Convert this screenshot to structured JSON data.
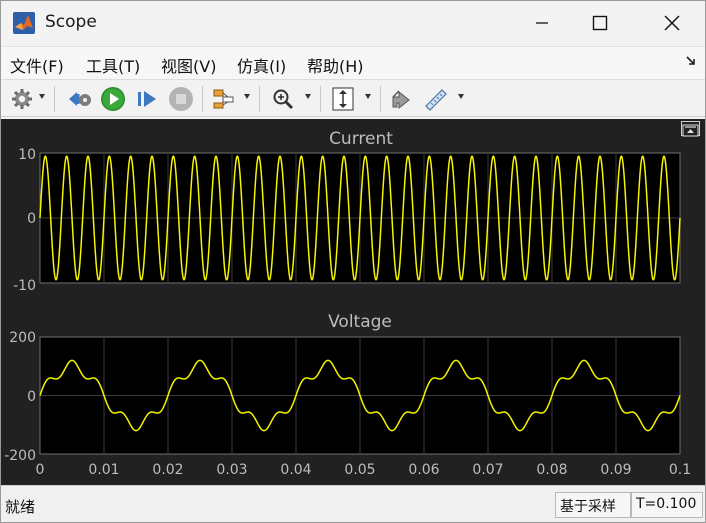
{
  "window": {
    "title": "Scope",
    "icons": {
      "app": "matlab-logo-icon",
      "minimize": "minimize-icon",
      "maximize": "maximize-icon",
      "close": "close-icon"
    }
  },
  "menu": {
    "items": [
      "文件(F)",
      "工具(T)",
      "视图(V)",
      "仿真(I)",
      "帮助(H)"
    ],
    "undock_icon": "undock-arrow-icon"
  },
  "toolbar": {
    "buttons": [
      "settings-gear-icon",
      "step-back-icon",
      "run-icon",
      "step-forward-icon",
      "stop-icon",
      "signal-highlight-icon",
      "zoom-icon",
      "autoscale-icon",
      "restore-view-icon",
      "measure-ruler-icon"
    ]
  },
  "plots": {
    "current": {
      "title": "Current",
      "yticks": [
        "10",
        "0",
        "-10"
      ]
    },
    "voltage": {
      "title": "Voltage",
      "yticks": [
        "200",
        "0",
        "-200"
      ]
    },
    "xticks": [
      "0",
      "0.01",
      "0.02",
      "0.03",
      "0.04",
      "0.05",
      "0.06",
      "0.07",
      "0.08",
      "0.09",
      "0.1"
    ],
    "trace_color": "#f5f500",
    "background_color": "#000000"
  },
  "chart_data": [
    {
      "type": "line",
      "title": "Current",
      "xlim": [
        0,
        0.1
      ],
      "ylim": [
        -10,
        10
      ],
      "grid": true,
      "series": [
        {
          "x_formula": "t",
          "y_formula": "9.5*sin(2*pi*300*t)",
          "amplitude": 9.5,
          "frequency_hz": 300
        }
      ]
    },
    {
      "type": "line",
      "title": "Voltage",
      "xlim": [
        0,
        0.1
      ],
      "ylim": [
        -200,
        200
      ],
      "grid": true,
      "series": [
        {
          "fundamental_hz": 50,
          "fundamental_amplitude": 100,
          "harmonic": 5,
          "harmonic_amplitude": 20
        }
      ]
    }
  ],
  "status": {
    "left": "就绪",
    "mode": "基于采样",
    "time": "T=0.100"
  }
}
